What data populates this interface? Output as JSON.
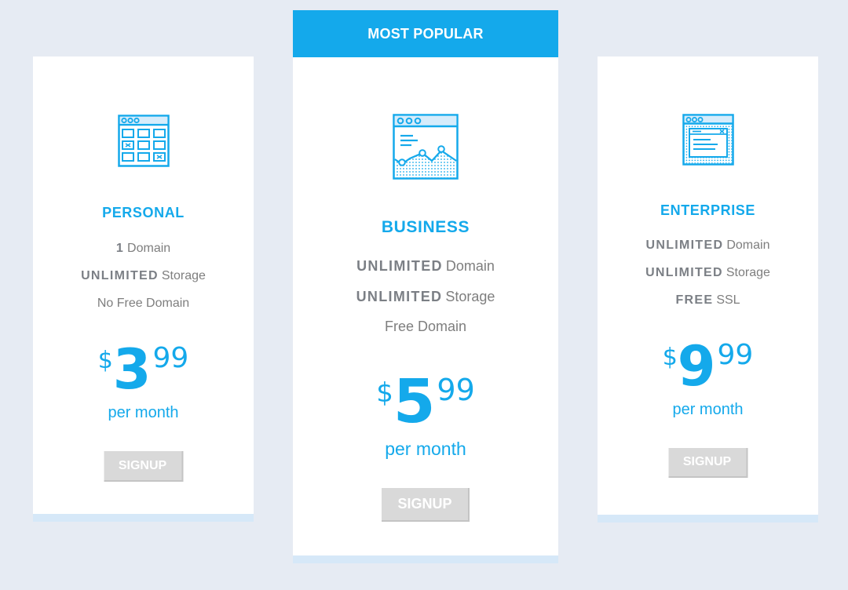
{
  "colors": {
    "background": "#e6ebf3",
    "accent": "#14a9eb",
    "card": "#ffffff",
    "button": "#d9d9d9",
    "text_muted": "#7e7e7e",
    "card_footer": "#d6e8f8"
  },
  "banner": {
    "label": "MOST POPULAR"
  },
  "plans": [
    {
      "icon": "calendar-grid-icon",
      "name": "PERSONAL",
      "features": [
        {
          "strong": "1",
          "text": "Domain"
        },
        {
          "strong": "UNLIMITED",
          "text": "Storage"
        },
        {
          "strong": "",
          "text": "No Free Domain"
        }
      ],
      "currency": "$",
      "price_whole": "3",
      "price_cents": "99",
      "period": "per month",
      "button": "SIGNUP"
    },
    {
      "icon": "browser-chart-icon",
      "name": "BUSINESS",
      "features": [
        {
          "strong": "UNLIMITED",
          "text": "Domain"
        },
        {
          "strong": "UNLIMITED",
          "text": "Storage"
        },
        {
          "strong": "",
          "text": "Free Domain"
        }
      ],
      "currency": "$",
      "price_whole": "5",
      "price_cents": "99",
      "period": "per month",
      "button": "SIGNUP"
    },
    {
      "icon": "browser-window-icon",
      "name": "ENTERPRISE",
      "features": [
        {
          "strong": "UNLIMITED",
          "text": "Domain"
        },
        {
          "strong": "UNLIMITED",
          "text": "Storage"
        },
        {
          "strong": "FREE",
          "text": "SSL"
        }
      ],
      "currency": "$",
      "price_whole": "9",
      "price_cents": "99",
      "period": "per month",
      "button": "SIGNUP"
    }
  ]
}
